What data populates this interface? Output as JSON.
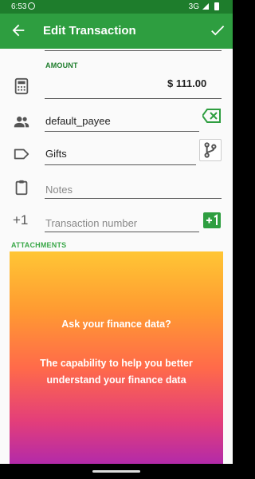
{
  "status_bar": {
    "time": "6:53",
    "network": "3G"
  },
  "app_bar": {
    "title": "Edit Transaction",
    "back_icon": "arrow-left-icon",
    "save_icon": "check-icon"
  },
  "form": {
    "amount_label": "AMOUNT",
    "amount_value": "$ 111.00",
    "payee_value": "default_payee",
    "category_value": "Gifts",
    "notes_placeholder": "Notes",
    "transaction_number_prefix": "+1",
    "transaction_number_placeholder": "Transaction number"
  },
  "attachments": {
    "label": "ATTACHMENTS",
    "image_line1": "Ask your finance data?",
    "image_line2": "The capability to help you better understand your finance data"
  },
  "colors": {
    "accent": "#2e9e40",
    "status_bar": "#1e7d2c",
    "label_green": "#1e7d2c"
  }
}
